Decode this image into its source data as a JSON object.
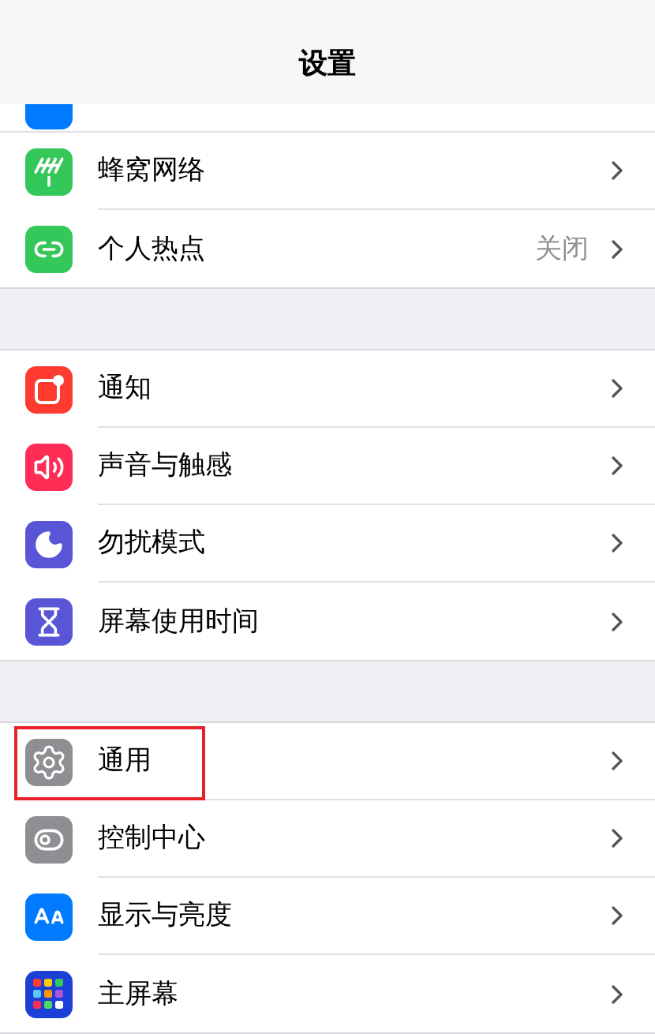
{
  "nav_bar": {
    "title": "设置"
  },
  "groups": [
    {
      "items": [
        {
          "kind": "cellular",
          "label": "蜂窝网络",
          "color": "#34c759",
          "highlighted": false
        },
        {
          "kind": "hotspot",
          "label": "个人热点",
          "value": "关闭",
          "color": "#34c759",
          "highlighted": false
        }
      ]
    },
    {
      "items": [
        {
          "kind": "notifications",
          "label": "通知",
          "color": "#ff3b30",
          "highlighted": false
        },
        {
          "kind": "sounds",
          "label": "声音与触感",
          "color": "#ff2d55",
          "highlighted": false
        },
        {
          "kind": "focus",
          "label": "勿扰模式",
          "color": "#5856d6",
          "highlighted": false
        },
        {
          "kind": "screentime",
          "label": "屏幕使用时间",
          "color": "#5856d6",
          "highlighted": false
        }
      ]
    },
    {
      "items": [
        {
          "kind": "general",
          "label": "通用",
          "color": "#8e8e93",
          "highlighted": true
        },
        {
          "kind": "control",
          "label": "控制中心",
          "color": "#8e8e93",
          "highlighted": false
        },
        {
          "kind": "display",
          "label": "显示与亮度",
          "color": "#007aff",
          "highlighted": false
        },
        {
          "kind": "home",
          "label": "主屏幕",
          "color": "#1c3fd6",
          "highlighted": false
        }
      ]
    }
  ]
}
